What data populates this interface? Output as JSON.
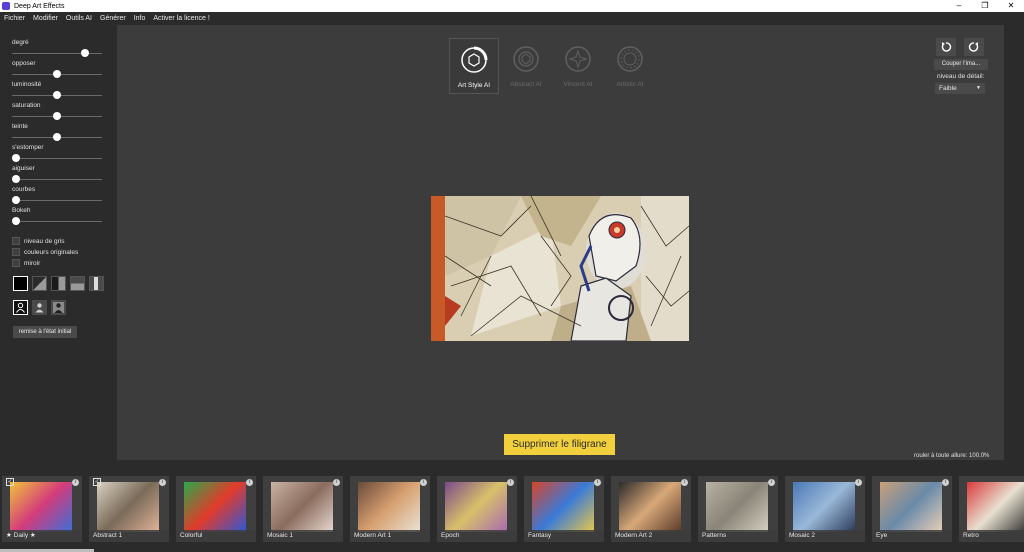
{
  "window": {
    "title": "Deep Art Effects"
  },
  "menu": [
    "Fichier",
    "Modifier",
    "Outils AI",
    "Générer",
    "Info",
    "Activer la licence !"
  ],
  "adjustments": {
    "sliders": [
      {
        "label": "degré",
        "value": 0.84
      },
      {
        "label": "opposer",
        "value": 0.5
      },
      {
        "label": "luminosité",
        "value": 0.5
      },
      {
        "label": "saturation",
        "value": 0.5
      },
      {
        "label": "teinte",
        "value": 0.5
      },
      {
        "label": "s'estomper",
        "value": 0.0
      },
      {
        "label": "aiguiser",
        "value": 0.0
      },
      {
        "label": "courbes",
        "value": 0.0
      },
      {
        "label": "Bokeh",
        "value": 0.0
      }
    ],
    "checkboxes": [
      "niveau de gris",
      "couleurs originales",
      "miroir"
    ],
    "reset_label": "remise à l'état initial"
  },
  "style_tabs": [
    {
      "label": "Art Style AI",
      "active": true
    },
    {
      "label": "Abstract AI",
      "active": false
    },
    {
      "label": "Vincent AI",
      "active": false
    },
    {
      "label": "Artistic AI",
      "active": false
    }
  ],
  "right_controls": {
    "crop_label": "Couper l'ima...",
    "detail_label": "niveau de détail:",
    "detail_value": "Faible"
  },
  "watermark_button": "Supprimer le filigrane",
  "speed_text": "rouler à toute allure: 100.0%",
  "styles": [
    {
      "name": "★ Daily ★",
      "checked": true,
      "palette": [
        "#f0c23a",
        "#d43c7c",
        "#3a6fd8"
      ]
    },
    {
      "name": "Abstract 1",
      "checked": true,
      "palette": [
        "#d9d2c4",
        "#7a6a58",
        "#e2b49a"
      ]
    },
    {
      "name": "Colorful",
      "checked": false,
      "palette": [
        "#2aa84a",
        "#e23b2a",
        "#2b57d8"
      ]
    },
    {
      "name": "Mosaic 1",
      "checked": false,
      "palette": [
        "#c9b3a4",
        "#8a6c5e",
        "#e8d8d0"
      ]
    },
    {
      "name": "Modern Art 1",
      "checked": false,
      "palette": [
        "#6a4a3a",
        "#d8a070",
        "#e9e2d6"
      ]
    },
    {
      "name": "Epoch",
      "checked": false,
      "palette": [
        "#7a4a8a",
        "#d8c06a",
        "#a86ab0"
      ]
    },
    {
      "name": "Fantasy",
      "checked": false,
      "palette": [
        "#d8452a",
        "#3a7ad8",
        "#e8c84a"
      ]
    },
    {
      "name": "Modern Art 2",
      "checked": false,
      "palette": [
        "#2a2a2a",
        "#d8a878",
        "#5a3a2a"
      ]
    },
    {
      "name": "Patterns",
      "checked": false,
      "palette": [
        "#b8b2a4",
        "#8a8478",
        "#d6d0c2"
      ]
    },
    {
      "name": "Mosaic 2",
      "checked": false,
      "palette": [
        "#4a78b8",
        "#9ab8d8",
        "#2a3a5a"
      ]
    },
    {
      "name": "Eye",
      "checked": false,
      "palette": [
        "#c8a07a",
        "#6a8aa8",
        "#e8d0b8"
      ]
    },
    {
      "name": "Retro",
      "checked": false,
      "palette": [
        "#d83a3a",
        "#e8e0d0",
        "#2a2a2a"
      ]
    }
  ]
}
